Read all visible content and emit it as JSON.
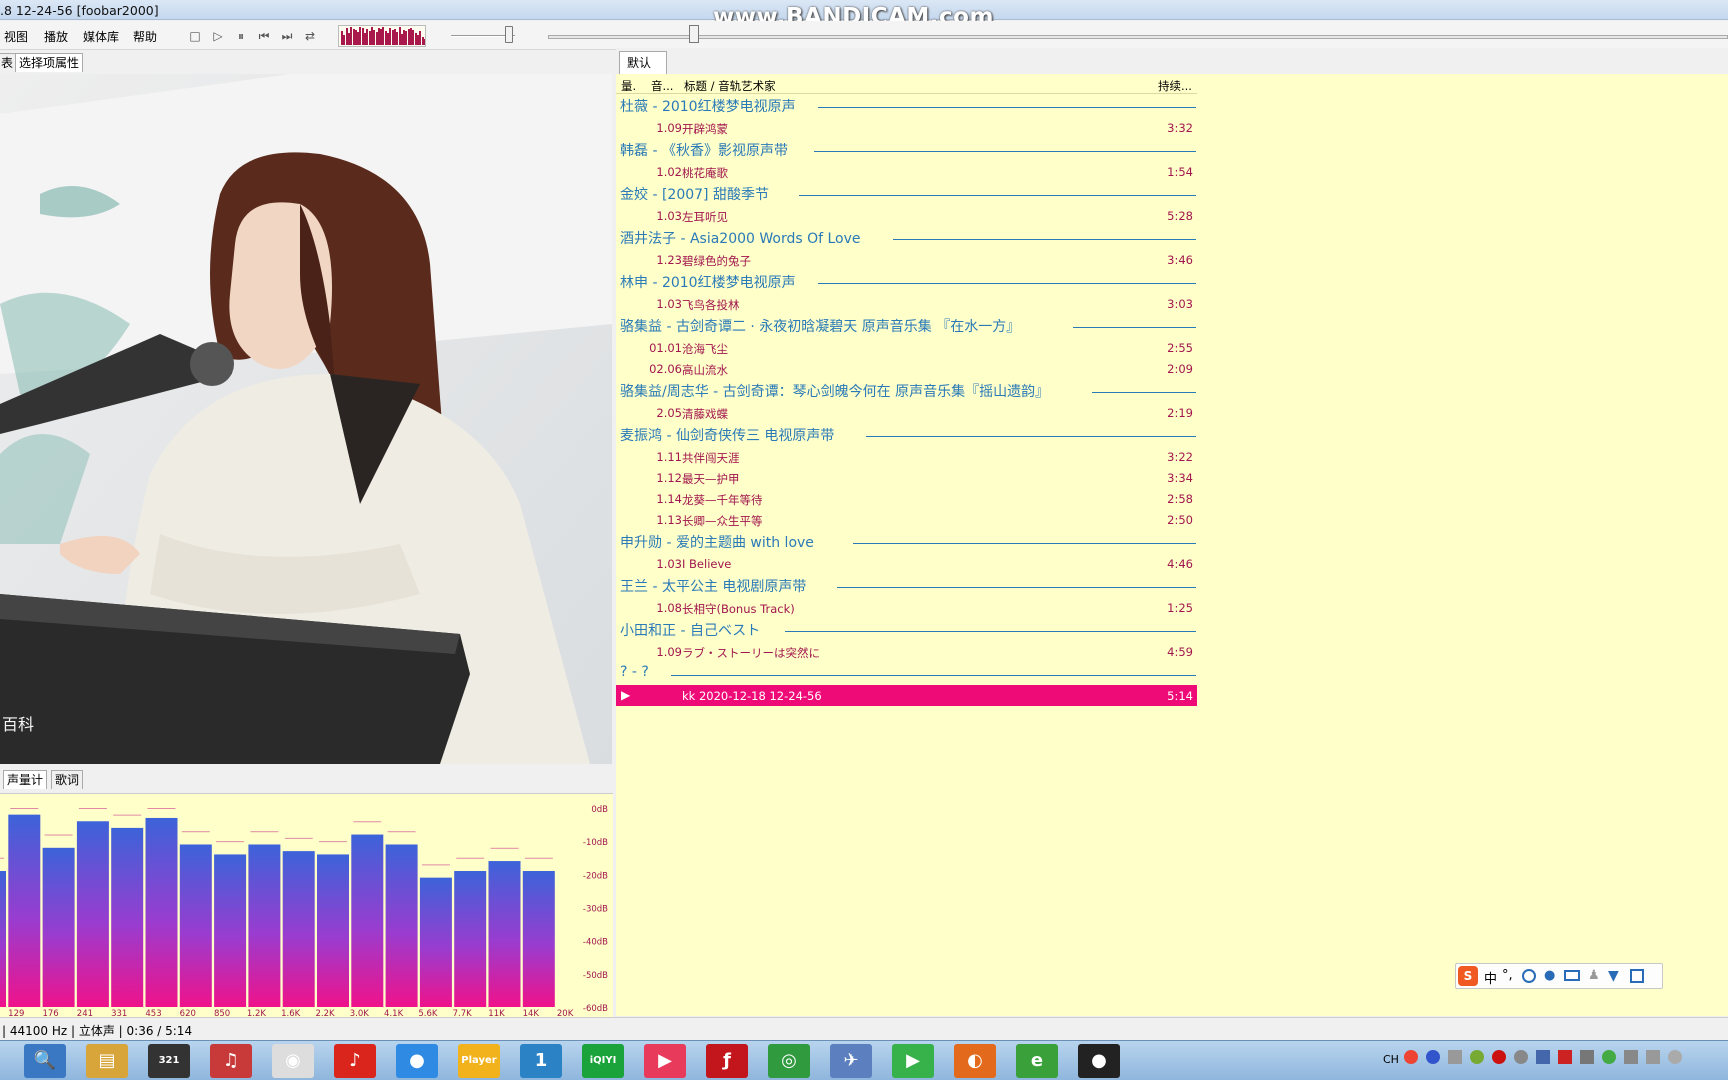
{
  "window": {
    "title": ".8 12-24-56  [foobar2000]",
    "watermark": "www.BANDICAM.com"
  },
  "menu": [
    "视图",
    "播放",
    "媒体库",
    "帮助"
  ],
  "toolbar_icons": [
    "stop-icon",
    "play-icon",
    "pause-icon",
    "prev-icon",
    "next-icon",
    "random-icon"
  ],
  "left_tabs": {
    "list": "表",
    "props": "选择项属性"
  },
  "bottom_tabs": {
    "meter": "声量计",
    "lyrics": "歌词"
  },
  "playlist_tab": "默认",
  "playlist_columns": {
    "c1": "量.",
    "c2": "音...",
    "c3": "标题 / 音轨艺术家",
    "c4": "持续..."
  },
  "playlist": [
    {
      "group": "杜薇 - 2010红楼梦电视原声",
      "tracks": [
        {
          "no": "1.09",
          "title": "开辟鸿蒙",
          "dur": "3:32"
        }
      ]
    },
    {
      "group": "韩磊 - 《秋香》影视原声带",
      "tracks": [
        {
          "no": "1.02",
          "title": "桃花庵歌",
          "dur": "1:54"
        }
      ]
    },
    {
      "group": "金姣 - [2007] 甜酸季节",
      "tracks": [
        {
          "no": "1.03",
          "title": "左耳听见",
          "dur": "5:28"
        }
      ]
    },
    {
      "group": "酒井法子 - Asia2000 Words Of Love",
      "tracks": [
        {
          "no": "1.23",
          "title": "碧绿色的兔子",
          "dur": "3:46"
        }
      ]
    },
    {
      "group": "林申 - 2010红楼梦电视原声",
      "tracks": [
        {
          "no": "1.03",
          "title": "飞鸟各投林",
          "dur": "3:03"
        }
      ]
    },
    {
      "group": "骆集益 - 古剑奇谭二 · 永夜初晗凝碧天 原声音乐集 『在水一方』",
      "tracks": [
        {
          "no": "01.01",
          "title": "沧海飞尘",
          "dur": "2:55"
        },
        {
          "no": "02.06",
          "title": "高山流水",
          "dur": "2:09"
        }
      ]
    },
    {
      "group": "骆集益/周志华 - 古剑奇谭：琴心剑魄今何在 原声音乐集『摇山遗韵』",
      "tracks": [
        {
          "no": "2.05",
          "title": "清藤戏蝶",
          "dur": "2:19"
        }
      ]
    },
    {
      "group": "麦振鸿 - 仙剑奇侠传三 电视原声带",
      "tracks": [
        {
          "no": "1.11",
          "title": "共伴闯天涯",
          "dur": "3:22"
        },
        {
          "no": "1.12",
          "title": "最天—护甲",
          "dur": "3:34"
        },
        {
          "no": "1.14",
          "title": "龙葵—千年等待",
          "dur": "2:58"
        },
        {
          "no": "1.13",
          "title": "长卿—众生平等",
          "dur": "2:50"
        }
      ]
    },
    {
      "group": "申升勋 - 爱的主题曲 with love",
      "tracks": [
        {
          "no": "1.03",
          "title": "I Believe",
          "dur": "4:46"
        }
      ]
    },
    {
      "group": "王兰 - 太平公主 电视剧原声带",
      "tracks": [
        {
          "no": "1.08",
          "title": "长相守(Bonus Track)",
          "dur": "1:25"
        }
      ]
    },
    {
      "group": "小田和正 - 自己ベスト",
      "tracks": [
        {
          "no": "1.09",
          "title": "ラブ・ストーリーは突然に",
          "dur": "4:59"
        }
      ]
    },
    {
      "group": "? - ?",
      "tracks": [
        {
          "no": "",
          "title": "kk 2020-12-18 12-24-56",
          "dur": "5:14",
          "playing": true
        }
      ]
    }
  ],
  "spectrum": {
    "db_labels": [
      "0dB",
      "-10dB",
      "-20dB",
      "-30dB",
      "-40dB",
      "-50dB",
      "-60dB"
    ],
    "freq_labels": [
      "129",
      "176",
      "241",
      "331",
      "453",
      "620",
      "850",
      "1.2K",
      "1.6K",
      "2.2K",
      "3.0K",
      "4.1K",
      "5.6K",
      "7.7K",
      "11K",
      "14K",
      "20K"
    ],
    "levels_db": [
      -19,
      -2,
      -12,
      -4,
      -6,
      -3,
      -11,
      -14,
      -11,
      -13,
      -14,
      -8,
      -11,
      -21,
      -19,
      -16,
      -19
    ]
  },
  "status": "| 44100 Hz | 立体声 | 0:36 / 5:14",
  "cover": {
    "caption": "百科"
  },
  "taskbar": {
    "apps": [
      {
        "name": "search-app",
        "glyph": "🔍",
        "color": "#3a78c4"
      },
      {
        "name": "explorer-app",
        "glyph": "▤",
        "color": "#d7a53a"
      },
      {
        "name": "video-app",
        "glyph": "321",
        "color": "#333"
      },
      {
        "name": "headphone-app",
        "glyph": "♫",
        "color": "#c83a3a"
      },
      {
        "name": "foobar-app",
        "glyph": "◉",
        "color": "#ddd"
      },
      {
        "name": "netease-app",
        "glyph": "♪",
        "color": "#d9251c"
      },
      {
        "name": "chrome-app",
        "glyph": "●",
        "color": "#2f8ae4"
      },
      {
        "name": "potplayer-app",
        "glyph": "Player",
        "color": "#f2b21b"
      },
      {
        "name": "app-1",
        "glyph": "1",
        "color": "#2b83c6"
      },
      {
        "name": "iqiyi-app",
        "glyph": "iQIYI",
        "color": "#1aa33b"
      },
      {
        "name": "youku-app",
        "glyph": "▶",
        "color": "#e83a5a"
      },
      {
        "name": "flash-app",
        "glyph": "ƒ",
        "color": "#c3161c"
      },
      {
        "name": "chrome2-app",
        "glyph": "◎",
        "color": "#2f9a3e"
      },
      {
        "name": "feather-app",
        "glyph": "✈",
        "color": "#5b7fbf"
      },
      {
        "name": "play-app",
        "glyph": "▶",
        "color": "#37b24a"
      },
      {
        "name": "firefox-app",
        "glyph": "◐",
        "color": "#e36a1c"
      },
      {
        "name": "ie-app",
        "glyph": "e",
        "color": "#3aa03a"
      },
      {
        "name": "bandicam-app",
        "glyph": "●",
        "color": "#222"
      }
    ],
    "tray": "CH"
  },
  "ime": {
    "label": "中"
  }
}
